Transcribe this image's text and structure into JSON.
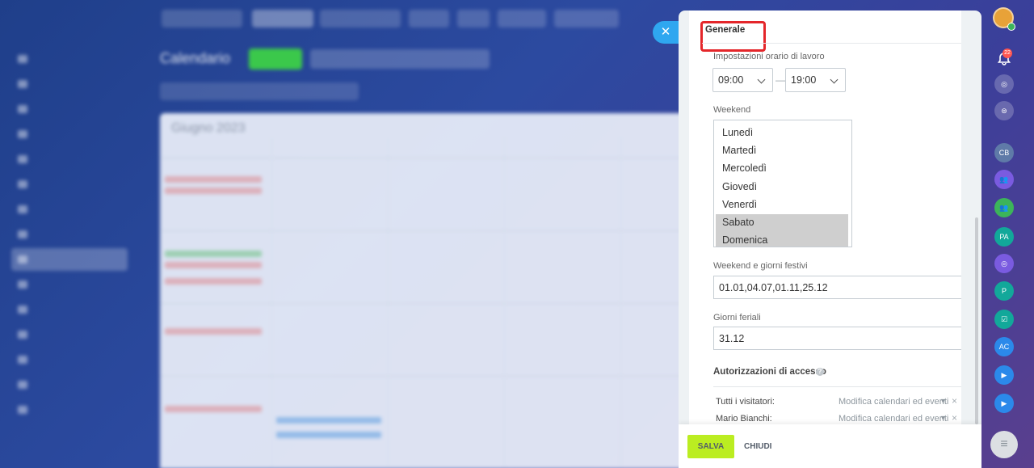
{
  "background_app": {
    "title": "Calendario",
    "month": "Giugno 2023"
  },
  "panel": {
    "section_tab": "Generale",
    "work_hours": {
      "label": "Impostazioni orario di lavoro",
      "start": "09:00",
      "separator": "—",
      "end": "19:00"
    },
    "weekend": {
      "label": "Weekend",
      "options": [
        {
          "label": "Lunedì",
          "selected": false
        },
        {
          "label": "Martedì",
          "selected": false
        },
        {
          "label": "Mercoledì",
          "selected": false
        },
        {
          "label": "Giovedì",
          "selected": false
        },
        {
          "label": "Venerdì",
          "selected": false
        },
        {
          "label": "Sabato",
          "selected": true
        },
        {
          "label": "Domenica",
          "selected": true
        }
      ]
    },
    "holidays": {
      "label": "Weekend e giorni festivi",
      "value": "01.01,04.07,01.11,25.12"
    },
    "workdays": {
      "label": "Giorni feriali",
      "value": "31.12"
    },
    "access": {
      "heading": "Autorizzazioni di accesso",
      "rows": [
        {
          "who": "Tutti i visitatori:",
          "permission": "Modifica calendari ed eventi"
        },
        {
          "who": "Mario Bianchi:",
          "permission": "Modifica calendari ed eventi"
        }
      ]
    },
    "footer": {
      "save_label": "SALVA",
      "close_label": "CHIUDI"
    }
  },
  "rail": {
    "notification_count": "22",
    "icons": [
      {
        "name": "CB"
      },
      {
        "name": "PA"
      },
      {
        "name": "P"
      },
      {
        "name": "AC"
      }
    ]
  },
  "colors": {
    "highlight": "#e4262a",
    "save_button": "#bbed21",
    "close_button": "#2fa7f0",
    "selected_option": "#cfcfcf"
  }
}
